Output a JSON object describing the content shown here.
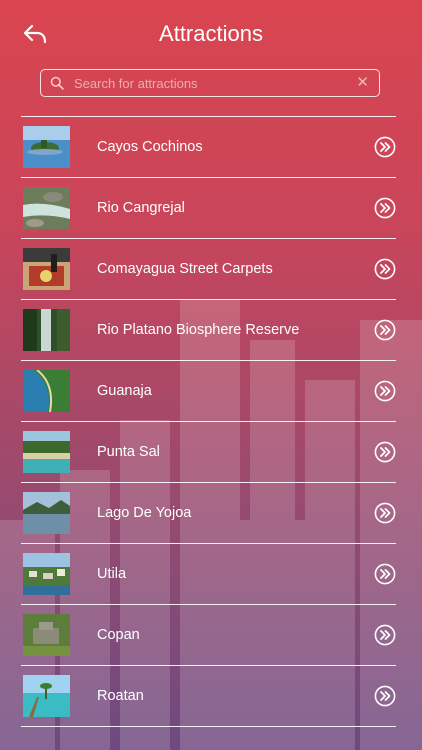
{
  "header": {
    "title": "Attractions",
    "back_icon": "back-arrow-icon"
  },
  "search": {
    "placeholder": "Search for attractions",
    "value": "",
    "icon": "search-icon",
    "clear_icon": "clear-icon"
  },
  "attractions": [
    {
      "label": "Cayos Cochinos",
      "thumb": "island-photo"
    },
    {
      "label": "Rio Cangrejal",
      "thumb": "river-photo"
    },
    {
      "label": "Comayagua Street Carpets",
      "thumb": "carpet-photo"
    },
    {
      "label": "Rio Platano Biosphere Reserve",
      "thumb": "waterfall-photo"
    },
    {
      "label": "Guanaja",
      "thumb": "coast-photo"
    },
    {
      "label": "Punta Sal",
      "thumb": "beach-photo"
    },
    {
      "label": "Lago De Yojoa",
      "thumb": "lake-photo"
    },
    {
      "label": "Utila",
      "thumb": "town-photo"
    },
    {
      "label": "Copan",
      "thumb": "ruins-photo"
    },
    {
      "label": "Roatan",
      "thumb": "pier-photo"
    }
  ],
  "colors": {
    "gradient_top": "#d9454f",
    "gradient_bottom": "#6e4a80",
    "text": "#ffffff"
  }
}
